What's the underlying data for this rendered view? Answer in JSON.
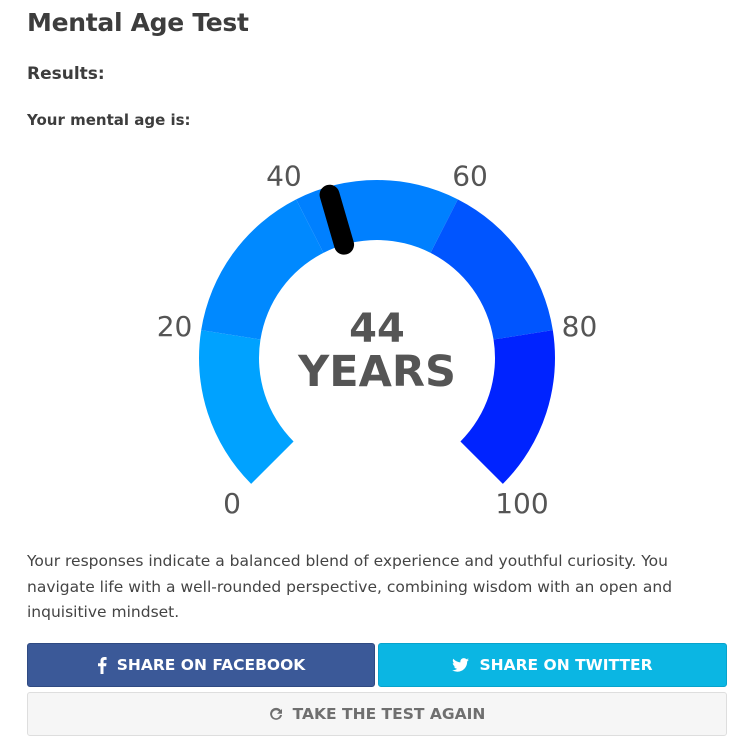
{
  "page": {
    "title": "Mental Age Test",
    "results_label": "Results:",
    "age_label": "Your mental age is:"
  },
  "gauge": {
    "min": 0,
    "max": 100,
    "value": 44,
    "value_text": "44",
    "unit_text": "YEARS",
    "tick_labels": [
      "0",
      "20",
      "40",
      "60",
      "80",
      "100"
    ],
    "segments": [
      {
        "from": 0,
        "to": 20,
        "color": "#00a2ff"
      },
      {
        "from": 20,
        "to": 40,
        "color": "#0089ff"
      },
      {
        "from": 40,
        "to": 60,
        "color": "#0080ff"
      },
      {
        "from": 60,
        "to": 80,
        "color": "#0055ff"
      },
      {
        "from": 80,
        "to": 100,
        "color": "#0023ff"
      }
    ],
    "needle_color": "#000000",
    "text_color": "#555555"
  },
  "description": "Your responses indicate a balanced blend of experience and youthful curiosity. You navigate life with a well-rounded perspective, combining wisdom with an open and inquisitive mindset.",
  "buttons": {
    "facebook": {
      "label": "SHARE ON FACEBOOK",
      "icon": "facebook-icon",
      "color": "#3b5998"
    },
    "twitter": {
      "label": "SHARE ON TWITTER",
      "icon": "twitter-icon",
      "color": "#0bb6e3"
    },
    "again": {
      "label": "TAKE THE TEST AGAIN",
      "icon": "refresh-icon",
      "color": "#f6f6f6"
    }
  }
}
